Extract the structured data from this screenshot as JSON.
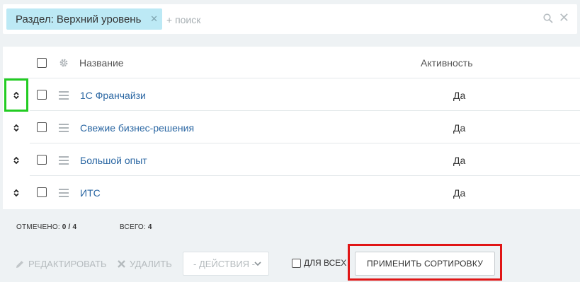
{
  "filter": {
    "chip_label": "Раздел: Верхний уровень",
    "search_placeholder": "+ поиск"
  },
  "grid": {
    "columns": {
      "name": "Название",
      "activity": "Активность"
    },
    "rows": [
      {
        "name": "1С Франчайзи",
        "activity": "Да"
      },
      {
        "name": "Свежие бизнес-решения",
        "activity": "Да"
      },
      {
        "name": "Большой опыт",
        "activity": "Да"
      },
      {
        "name": "ИТС",
        "activity": "Да"
      }
    ]
  },
  "stats": {
    "checked_label": "ОТМЕЧЕНО:",
    "checked_value": "0 / 4",
    "total_label": "ВСЕГО:",
    "total_value": "4"
  },
  "actions": {
    "edit": "РЕДАКТИРОВАТЬ",
    "delete": "УДАЛИТЬ",
    "actions_select": "- ДЕЙСТВИЯ -",
    "for_all": "ДЛЯ ВСЕХ",
    "apply_sort": "ПРИМЕНИТЬ СОРТИРОВКУ"
  },
  "colors": {
    "chip_bg": "#bce9f5",
    "link": "#2b67a3",
    "highlight_green": "#22cc22",
    "highlight_red": "#e01515"
  },
  "icons": [
    "close-icon",
    "search-icon",
    "clear-icon",
    "gear-icon",
    "drag-handle-icon",
    "sort-arrows-icon",
    "pencil-icon",
    "x-icon",
    "chevron-down-icon"
  ]
}
